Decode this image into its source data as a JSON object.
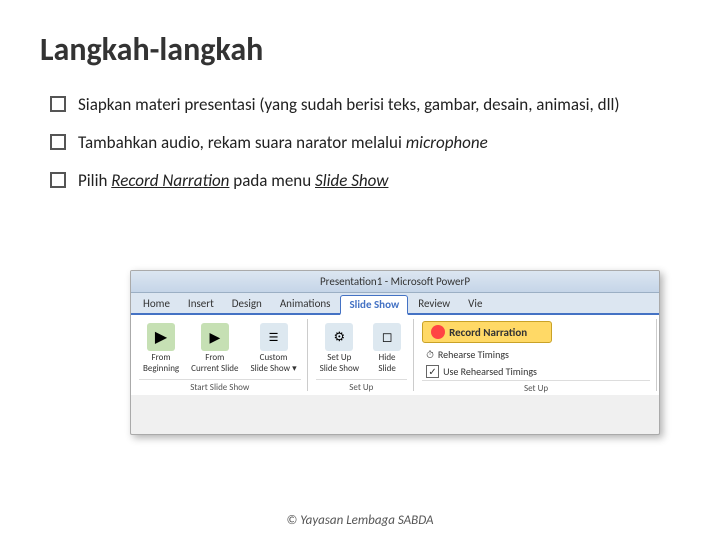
{
  "slide": {
    "title": "Langkah-langkah",
    "bullets": [
      {
        "id": 1,
        "text": "Siapkan materi presentasi (yang sudah berisi teks, gambar, desain, animasi, dll)"
      },
      {
        "id": 2,
        "text": "Tambahkan audio, rekam suara narator melalui microphone",
        "italic_word": "microphone"
      },
      {
        "id": 3,
        "text": "Pilih Record Narration pada menu Slide Show"
      }
    ]
  },
  "ribbon": {
    "title": "Presentation1 - Microsoft PowerP",
    "tabs": [
      "Home",
      "Insert",
      "Design",
      "Animations",
      "Slide Show",
      "Review",
      "Vie"
    ],
    "active_tab": "Slide Show",
    "groups": {
      "start_slide_show": {
        "label": "Start Slide Show",
        "buttons": [
          {
            "id": "from-beginning",
            "label": "From\nBeginning",
            "icon": "▶"
          },
          {
            "id": "from-current",
            "label": "From\nCurrent Slide",
            "icon": "▶"
          },
          {
            "id": "custom",
            "label": "Custom\nSlide Show ▾",
            "icon": "☰"
          }
        ]
      },
      "set_up": {
        "label": "Set Up",
        "buttons": [
          {
            "id": "set-up-slideshow",
            "label": "Set Up\nSlide Show",
            "icon": "⚙"
          },
          {
            "id": "hide-slide",
            "label": "Hide\nSlide",
            "icon": "◻"
          }
        ]
      },
      "record": {
        "label": "Set Up",
        "record_narration": "Record Narration",
        "rehearse_timings": "Rehearse Timings",
        "use_rehearsed": "Use Rehearsed Timings"
      }
    }
  },
  "footer": {
    "text": "© Yayasan Lembaga SABDA"
  }
}
